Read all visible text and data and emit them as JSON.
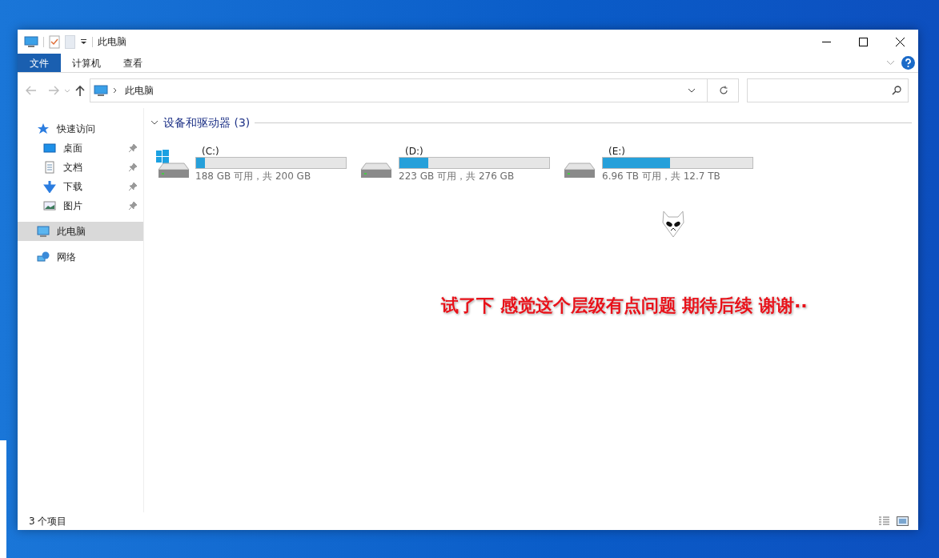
{
  "window": {
    "title": "此电脑"
  },
  "ribbon_tabs": [
    {
      "label": "文件",
      "kind": "file"
    },
    {
      "label": "计算机",
      "kind": "tab"
    },
    {
      "label": "查看",
      "kind": "tab"
    }
  ],
  "address": {
    "path": "此电脑"
  },
  "sidebar": {
    "items": [
      {
        "label": "快速访问",
        "kind": "star",
        "selected": false,
        "children": [
          {
            "label": "桌面",
            "kind": "desktop",
            "pinned": true,
            "selected": false
          },
          {
            "label": "文档",
            "kind": "document",
            "pinned": true,
            "selected": false
          },
          {
            "label": "下载",
            "kind": "download",
            "pinned": true,
            "selected": false
          },
          {
            "label": "图片",
            "kind": "pictures",
            "pinned": true,
            "selected": false
          }
        ]
      },
      {
        "label": "此电脑",
        "kind": "pc",
        "selected": true
      },
      {
        "label": "网络",
        "kind": "network",
        "selected": false
      }
    ]
  },
  "section": {
    "title": "设备和驱动器 (3)",
    "expanded": true
  },
  "drives": [
    {
      "name": "(C:)",
      "usage": "188 GB 可用，共 200 GB",
      "level": 0.06,
      "system": true
    },
    {
      "name": "(D:)",
      "usage": "223 GB 可用，共 276 GB",
      "level": 0.19,
      "system": false
    },
    {
      "name": "(E:)",
      "usage": "6.96 TB 可用，共 12.7 TB",
      "level": 0.45,
      "system": false
    }
  ],
  "caption": "试了下 感觉这个层级有点问题 期待后续 谢谢··",
  "status_bar": {
    "count": "3 个项目"
  }
}
